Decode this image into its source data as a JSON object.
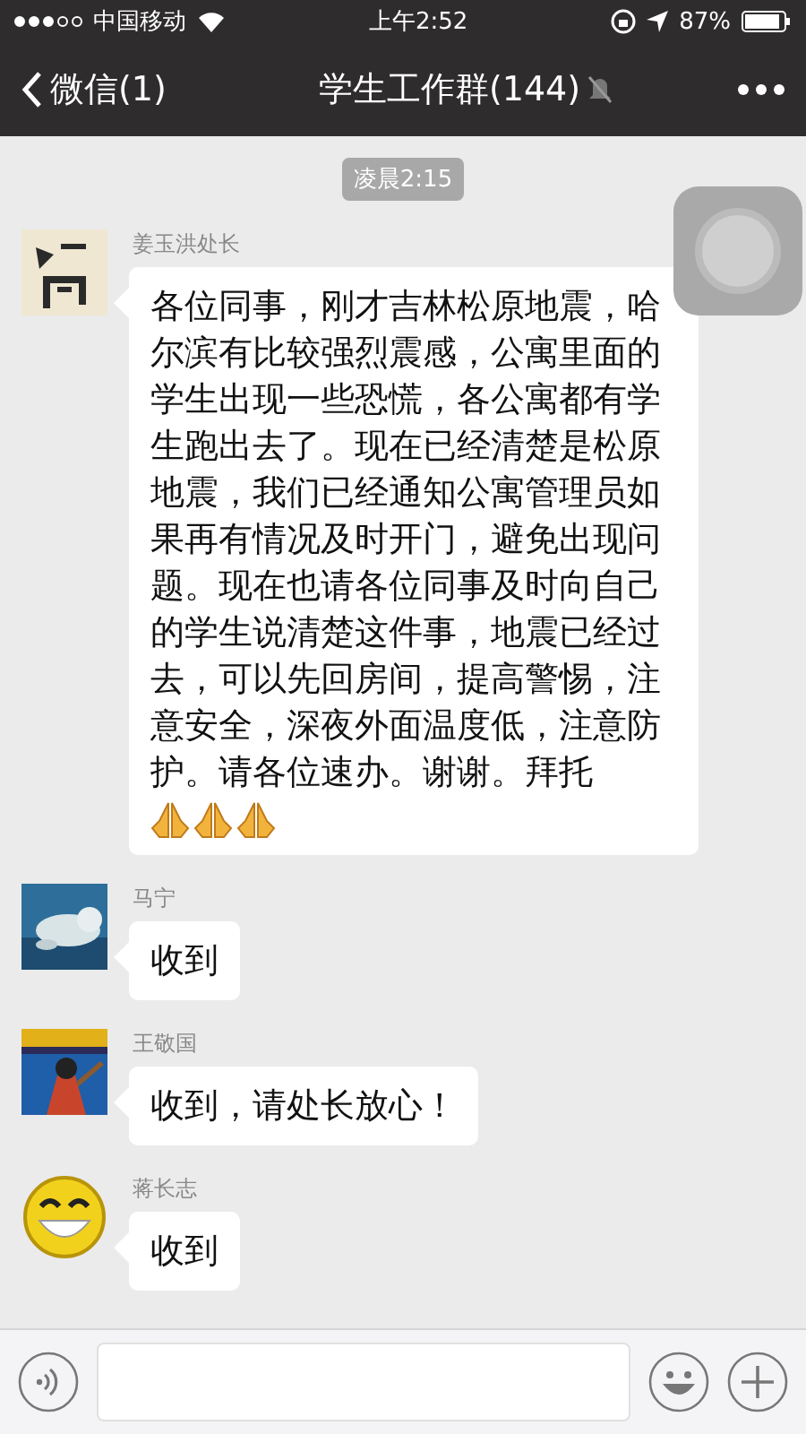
{
  "status_bar": {
    "carrier": "中国移动",
    "time": "上午2:52",
    "battery": "87%"
  },
  "nav": {
    "back": "微信(1)",
    "title": "学生工作群(144)",
    "muted": true
  },
  "timestamp": "凌晨2:15",
  "messages": [
    {
      "sender": "姜玉洪处长",
      "avatar": {
        "kind": "picture"
      },
      "text": "各位同事，刚才吉林松原地震，哈尔滨有比较强烈震感，公寓里面的学生出现一些恐慌，各公寓都有学生跑出去了。现在已经清楚是松原地震，我们已经通知公寓管理员如果再有情况及时开门，避免出现问题。现在也请各位同事及时向自己的学生说清楚这件事，地震已经过去，可以先回房间，提高警惕，注意安全，深夜外面温度低，注意防护。请各位速办。谢谢。拜托",
      "emojis": [
        {
          "kind": "pray"
        },
        {
          "kind": "pray"
        },
        {
          "kind": "pray"
        }
      ]
    },
    {
      "sender": "马宁",
      "avatar": {
        "kind": "picture"
      },
      "text": "收到"
    },
    {
      "sender": "王敬国",
      "avatar": {
        "kind": "picture"
      },
      "text": "收到，请处长放心！"
    },
    {
      "sender": "蒋长志",
      "avatar": {
        "kind": "smiley"
      },
      "text": "收到"
    }
  ]
}
